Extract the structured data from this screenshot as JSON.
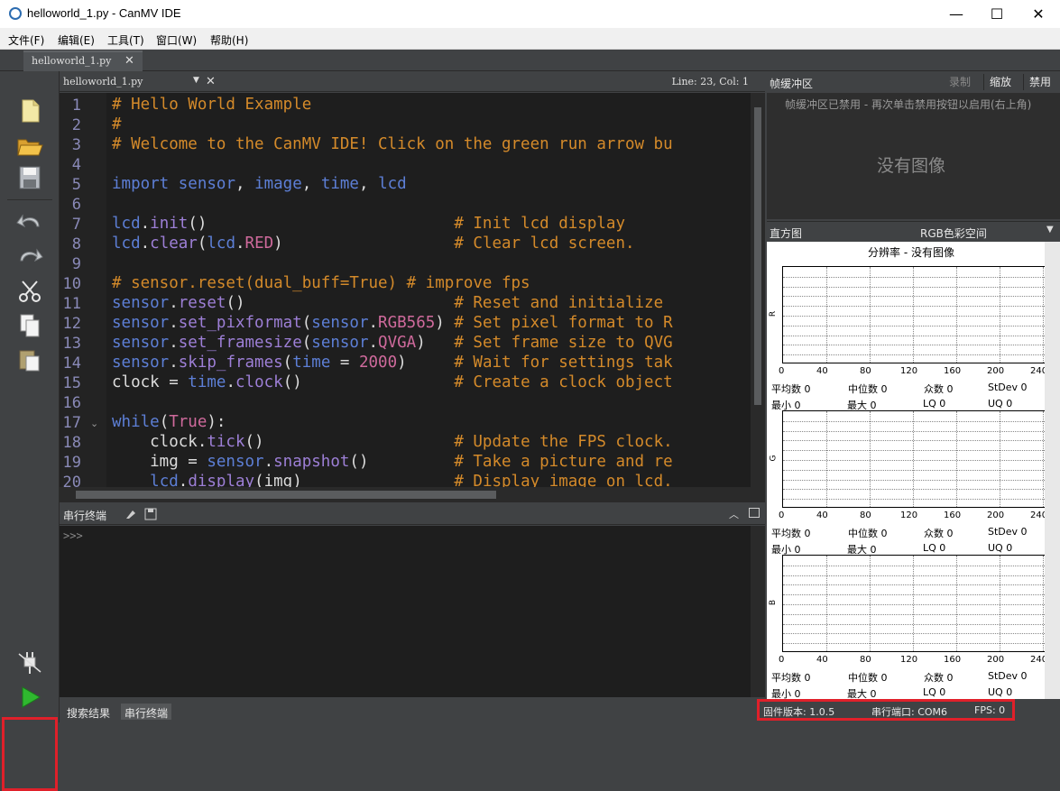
{
  "window": {
    "title": "helloworld_1.py - CanMV IDE",
    "minimize": "—",
    "maximize": "☐",
    "close": "✕"
  },
  "menu": [
    "文件(F)",
    "编辑(E)",
    "工具(T)",
    "窗口(W)",
    "帮助(H)"
  ],
  "tab": {
    "label": "helloworld_1.py",
    "close": "✕"
  },
  "editor": {
    "file": "helloworld_1.py",
    "position": "Line: 23, Col: 1",
    "lines": [
      "# Hello World Example",
      "#",
      "# Welcome to the CanMV IDE! Click on the green run arrow bu",
      "",
      "import sensor, image, time, lcd",
      "",
      "lcd.init()                          # Init lcd display",
      "lcd.clear(lcd.RED)                  # Clear lcd screen.",
      "",
      "# sensor.reset(dual_buff=True) # improve fps",
      "sensor.reset()                      # Reset and initialize",
      "sensor.set_pixformat(sensor.RGB565) # Set pixel format to R",
      "sensor.set_framesize(sensor.QVGA)   # Set frame size to QVG",
      "sensor.skip_frames(time = 2000)     # Wait for settings tak",
      "clock = time.clock()                # Create a clock object",
      "",
      "while(True):",
      "    clock.tick()                    # Update the FPS clock.",
      "    img = sensor.snapshot()         # Take a picture and re",
      "    lcd.display(img)                # Display image on lcd."
    ]
  },
  "terminal": {
    "label": "串行终端",
    "prompt": ">>>"
  },
  "bottom_tabs": [
    "搜索结果",
    "串行终端"
  ],
  "status": {
    "firmware": "固件版本: 1.0.5",
    "port": "串行端口: COM6",
    "fps": "FPS: 0"
  },
  "framebuffer": {
    "label": "帧缓冲区",
    "record": "录制",
    "zoom": "缩放",
    "disable": "禁用",
    "message": "帧缓冲区已禁用 - 再次单击禁用按钮以启用(右上角)",
    "no_image": "没有图像"
  },
  "histogram": {
    "label": "直方图",
    "colorspace": "RGB色彩空间",
    "resolution": "分辨率 - 没有图像",
    "ticks": [
      "0",
      "40",
      "80",
      "120",
      "160",
      "200",
      "240"
    ],
    "channels": [
      {
        "name": "R",
        "mean": "平均数 0",
        "median": "中位数 0",
        "mode": "众数 0",
        "stdev": "StDev 0",
        "min": "最小  0",
        "max": "最大  0",
        "lq": "LQ  0",
        "uq": "UQ  0"
      },
      {
        "name": "G",
        "mean": "平均数 0",
        "median": "中位数 0",
        "mode": "众数 0",
        "stdev": "StDev 0",
        "min": "最小  0",
        "max": "最大  0",
        "lq": "LQ  0",
        "uq": "UQ  0"
      },
      {
        "name": "B",
        "mean": "平均数 0",
        "median": "中位数 0",
        "mode": "众数 0",
        "stdev": "StDev 0",
        "min": "最小  0",
        "max": "最大  0",
        "lq": "LQ  0",
        "uq": "UQ  0"
      }
    ]
  }
}
